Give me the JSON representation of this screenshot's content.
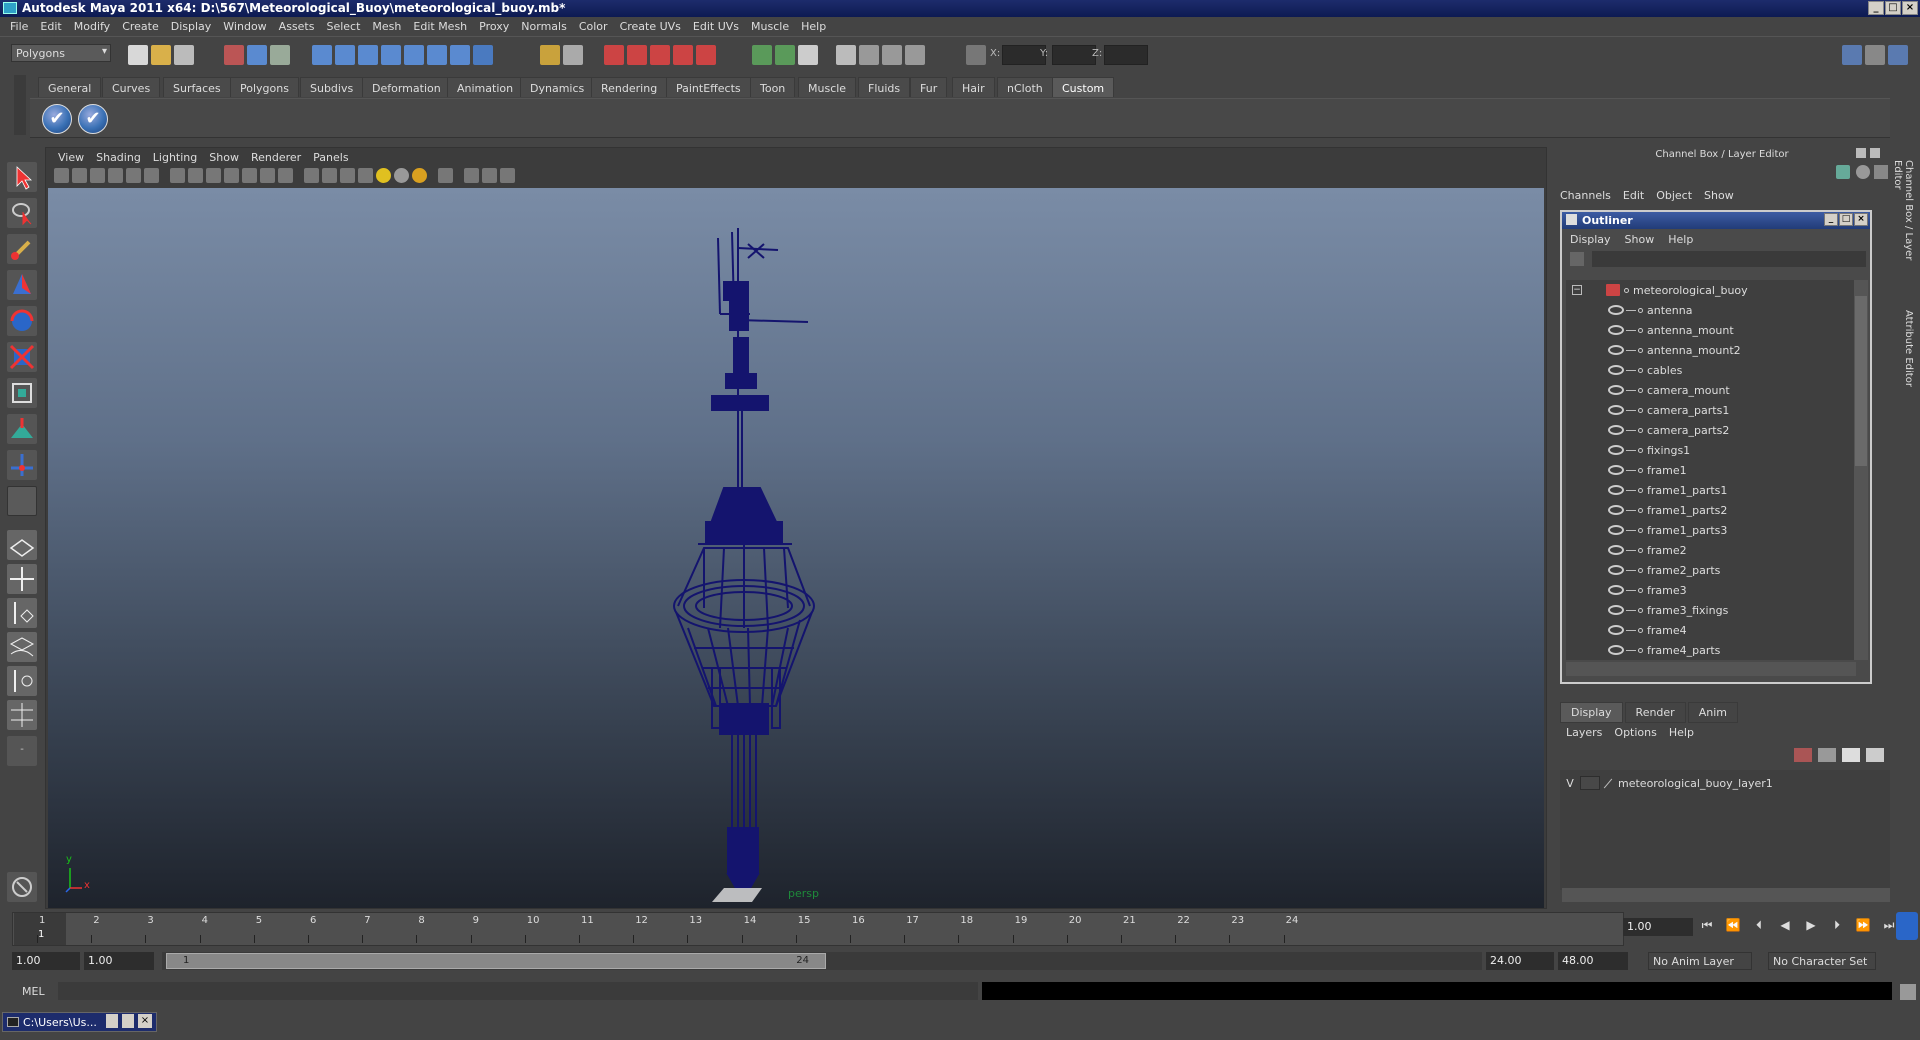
{
  "window": {
    "title": "Autodesk Maya 2011 x64: D:\\567\\Meteorological_Buoy\\meteorological_buoy.mb*",
    "controls": [
      "_",
      "□",
      "×"
    ]
  },
  "menubar": [
    "File",
    "Edit",
    "Modify",
    "Create",
    "Display",
    "Window",
    "Assets",
    "Select",
    "Mesh",
    "Edit Mesh",
    "Proxy",
    "Normals",
    "Color",
    "Create UVs",
    "Edit UVs",
    "Muscle",
    "Help"
  ],
  "status_line": {
    "mode": "Polygons",
    "x_label": "X:",
    "y_label": "Y:",
    "z_label": "Z:",
    "x_value": "",
    "y_value": "",
    "z_value": ""
  },
  "shelf_tabs": [
    {
      "label": "General"
    },
    {
      "label": "Curves"
    },
    {
      "label": "Surfaces"
    },
    {
      "label": "Polygons"
    },
    {
      "label": "Subdivs"
    },
    {
      "label": "Deformation"
    },
    {
      "label": "Animation"
    },
    {
      "label": "Dynamics"
    },
    {
      "label": "Rendering"
    },
    {
      "label": "PaintEffects"
    },
    {
      "label": "Toon"
    },
    {
      "label": "Muscle"
    },
    {
      "label": "Fluids"
    },
    {
      "label": "Fur"
    },
    {
      "label": "Hair"
    },
    {
      "label": "nCloth"
    },
    {
      "label": "Custom"
    }
  ],
  "active_shelf": "Custom",
  "panel": {
    "menu": [
      "View",
      "Shading",
      "Lighting",
      "Show",
      "Renderer",
      "Panels"
    ],
    "camera": "persp",
    "axis_x": "x",
    "axis_y": "y"
  },
  "channel_box": {
    "title": "Channel Box / Layer Editor",
    "menu": [
      "Channels",
      "Edit",
      "Object",
      "Show"
    ],
    "side_tabs": [
      "Channel Box / Layer Editor",
      "Attribute Editor"
    ]
  },
  "outliner": {
    "title": "Outliner",
    "menu": [
      "Display",
      "Show",
      "Help"
    ],
    "root": "meteorological_buoy",
    "items": [
      "antenna",
      "antenna_mount",
      "antenna_mount2",
      "cables",
      "camera_mount",
      "camera_parts1",
      "camera_parts2",
      "fixings1",
      "frame1",
      "frame1_parts1",
      "frame1_parts2",
      "frame1_parts3",
      "frame2",
      "frame2_parts",
      "frame3",
      "frame3_fixings",
      "frame4",
      "frame4_parts"
    ]
  },
  "layer_editor": {
    "tabs": [
      "Display",
      "Render",
      "Anim"
    ],
    "active_tab": "Display",
    "menu": [
      "Layers",
      "Options",
      "Help"
    ],
    "layers": [
      {
        "visible": "V",
        "name": "meteorological_buoy_layer1"
      }
    ]
  },
  "time_slider": {
    "ticks": [
      "1",
      "2",
      "3",
      "4",
      "5",
      "6",
      "7",
      "8",
      "9",
      "10",
      "11",
      "12",
      "13",
      "14",
      "15",
      "16",
      "17",
      "18",
      "19",
      "20",
      "21",
      "22",
      "23",
      "24"
    ],
    "current_frame_marker": "1",
    "current_time": "1.00"
  },
  "range_slider": {
    "start_time": "1.00",
    "playback_start": "1.00",
    "range_start_label": "1",
    "range_end_label": "24",
    "playback_end": "24.00",
    "end_time": "48.00",
    "anim_layer": "No Anim Layer",
    "character_set": "No Character Set"
  },
  "command_line": {
    "label": "MEL"
  },
  "taskbar": {
    "item": "C:\\Users\\Us..."
  },
  "colors": {
    "model_wire": "#14146e",
    "viewport_top": "#7a8ca6",
    "viewport_bottom": "#1e232c",
    "titlebar": "#1d2c6c"
  }
}
